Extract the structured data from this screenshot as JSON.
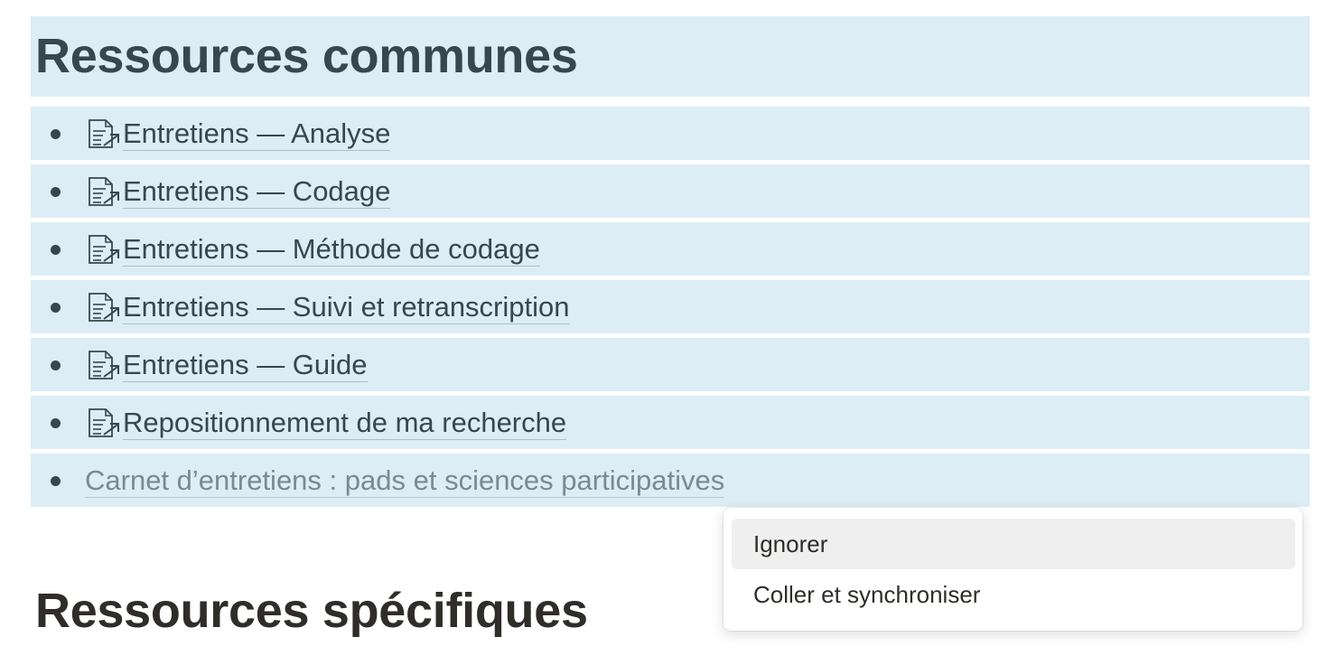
{
  "section_common": {
    "title": "Ressources communes",
    "items": [
      {
        "label": "Entretiens — Analyse",
        "icon": "linked-page-icon"
      },
      {
        "label": "Entretiens — Codage",
        "icon": "linked-page-icon"
      },
      {
        "label": "Entretiens — Méthode de codage",
        "icon": "linked-page-icon"
      },
      {
        "label": "Entretiens — Suivi et retranscription",
        "icon": "linked-page-icon"
      },
      {
        "label": "Entretiens — Guide",
        "icon": "linked-page-icon"
      },
      {
        "label": "Repositionnement de ma recherche",
        "icon": "linked-page-icon"
      },
      {
        "label": "Carnet d’entretiens : pads et sciences participatives"
      }
    ]
  },
  "context_menu": {
    "items": [
      {
        "label": "Ignorer"
      },
      {
        "label": "Coller et synchroniser"
      }
    ]
  },
  "section_specific": {
    "title": "Ressources spécifiques"
  },
  "colors": {
    "highlight_background": "#dcedf5",
    "text_dark": "#37474f",
    "menu_hover": "#efefef"
  }
}
